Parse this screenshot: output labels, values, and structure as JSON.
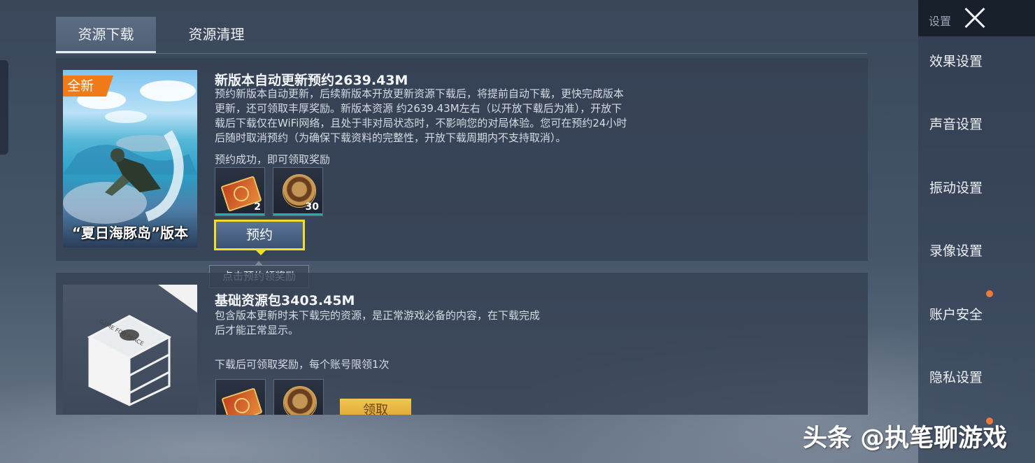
{
  "tabs": {
    "download": "资源下载",
    "cleanup": "资源清理"
  },
  "card1": {
    "badge": "全新",
    "thumb_caption": "“夏日海豚岛”版本",
    "title": "新版本自动更新预约2639.43M",
    "description_lines": [
      "预约新版本自动更新，后续新版本开放更新资源下载后，将提前自动下载，更快完成版本",
      "更新，还可领取丰厚奖励。新版本资源 约2639.43M左右（以开放下载后为准），开放下",
      "载后下载仅在WiFi网络，且处于非对局状态时，不影响您的对局体验。您可在预约24小时",
      "后随时取消预约（为确保下载资料的完整性，开放下载周期内不支持取消）。"
    ],
    "reward_note": "预约成功，即可领取奖励",
    "rewards": [
      {
        "icon": "ticket-icon",
        "qty": "2"
      },
      {
        "icon": "medal-icon",
        "qty": "30"
      }
    ],
    "button": "预约",
    "tooltip": "点击预约领奖励"
  },
  "card2": {
    "title": "基础资源包3403.45M",
    "description_lines": [
      "包含版本更新时未下载完的资源，是正常游戏必备的内容，在下载完成",
      "后才能正常显示。"
    ],
    "reward_note": "下载后可领取奖励，每个账号限领1次",
    "rewards": [
      {
        "icon": "ticket-icon"
      },
      {
        "icon": "medal-icon"
      }
    ],
    "button": "领取",
    "box_text": "GAME FOR PEACE"
  },
  "sidebar": {
    "header": "设置",
    "items": [
      "效果设置",
      "声音设置",
      "振动设置",
      "录像设置",
      "账户安全",
      "隐私设置"
    ]
  },
  "watermark": "头条 @执笔聊游戏",
  "colors": {
    "accent_yellow": "#f4dc2a",
    "badge_orange": "#f07a18",
    "notify_dot": "#ee7a3a",
    "reward_bar": "#19b0a5"
  }
}
